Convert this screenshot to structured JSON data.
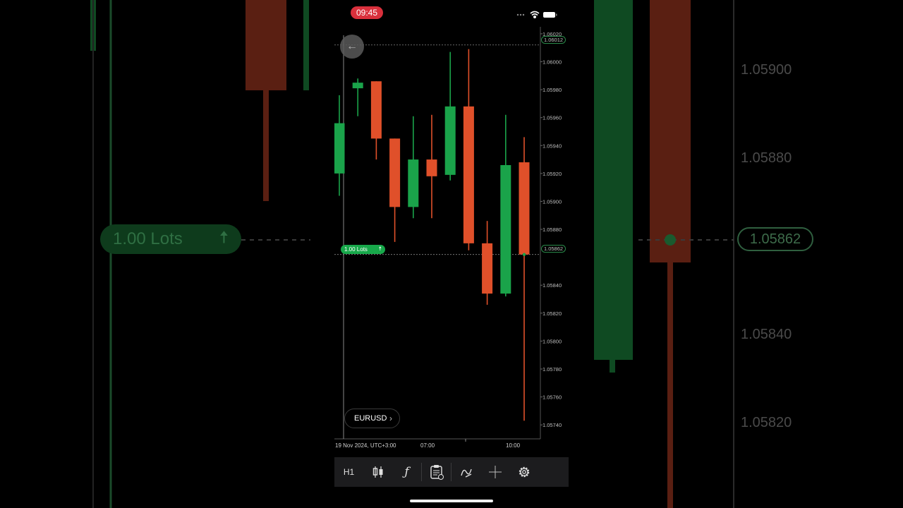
{
  "status_bar": {
    "time": "09:45"
  },
  "chart_data": {
    "type": "candlestick",
    "symbol": "EURUSD",
    "timeframe": "H1",
    "ylim": [
      1.0573,
      1.06025
    ],
    "y_ticks": [
      "1.06020",
      "1.06000",
      "1.05980",
      "1.05960",
      "1.05940",
      "1.05920",
      "1.05900",
      "1.05880",
      "1.05840",
      "1.05820",
      "1.05800",
      "1.05780",
      "1.05760",
      "1.05740"
    ],
    "x_labels": [
      "19 Nov 2024, UTC+3:00",
      "07:00",
      "10:00"
    ],
    "candles": [
      {
        "open": 1.0592,
        "high": 1.05976,
        "low": 1.05904,
        "close": 1.05956,
        "color": "green"
      },
      {
        "open": 1.05981,
        "high": 1.05988,
        "low": 1.05961,
        "close": 1.05985,
        "color": "green"
      },
      {
        "open": 1.05986,
        "high": 1.05986,
        "low": 1.0593,
        "close": 1.05945,
        "color": "red"
      },
      {
        "open": 1.05945,
        "high": 1.05945,
        "low": 1.05871,
        "close": 1.05896,
        "color": "red"
      },
      {
        "open": 1.05896,
        "high": 1.05961,
        "low": 1.05888,
        "close": 1.0593,
        "color": "green"
      },
      {
        "open": 1.0593,
        "high": 1.05962,
        "low": 1.05888,
        "close": 1.05918,
        "color": "red"
      },
      {
        "open": 1.05919,
        "high": 1.06007,
        "low": 1.05915,
        "close": 1.05968,
        "color": "green"
      },
      {
        "open": 1.05968,
        "high": 1.06009,
        "low": 1.05865,
        "close": 1.0587,
        "color": "red"
      },
      {
        "open": 1.0587,
        "high": 1.05886,
        "low": 1.05826,
        "close": 1.05834,
        "color": "red"
      },
      {
        "open": 1.05834,
        "high": 1.05962,
        "low": 1.05832,
        "close": 1.05926,
        "color": "green"
      },
      {
        "open": 1.05928,
        "high": 1.05946,
        "low": 1.05743,
        "close": 1.05862,
        "color": "red"
      }
    ],
    "current_price": "1.05862",
    "top_line_price": "1.06012"
  },
  "order": {
    "lots_label": "1.00 Lots",
    "direction_icon": "up-arrow-icon"
  },
  "toolbar": {
    "timeframe_label": "H1",
    "icons": [
      "candlestick-icon",
      "function-icon",
      "order-list-icon",
      "drawing-icon",
      "crosshair-icon",
      "settings-gear-icon"
    ]
  },
  "background": {
    "axis_labels": [
      "1.05900",
      "1.05880",
      "1.05840",
      "1.05820"
    ],
    "lots_label": "1.00 Lots",
    "price_badge": "1.05862"
  },
  "colors": {
    "bull": "#1aa34a",
    "bear": "#e0502a",
    "bg": "#000000"
  }
}
